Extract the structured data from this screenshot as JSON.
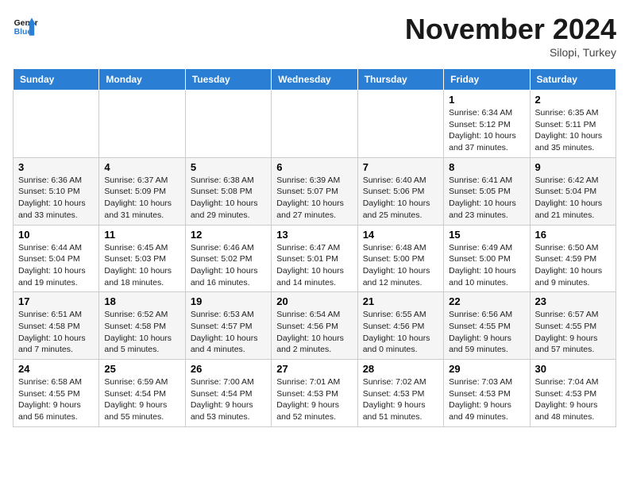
{
  "header": {
    "logo_line1": "General",
    "logo_line2": "Blue",
    "month": "November 2024",
    "location": "Silopi, Turkey"
  },
  "weekdays": [
    "Sunday",
    "Monday",
    "Tuesday",
    "Wednesday",
    "Thursday",
    "Friday",
    "Saturday"
  ],
  "weeks": [
    [
      {
        "day": "",
        "detail": ""
      },
      {
        "day": "",
        "detail": ""
      },
      {
        "day": "",
        "detail": ""
      },
      {
        "day": "",
        "detail": ""
      },
      {
        "day": "",
        "detail": ""
      },
      {
        "day": "1",
        "detail": "Sunrise: 6:34 AM\nSunset: 5:12 PM\nDaylight: 10 hours\nand 37 minutes."
      },
      {
        "day": "2",
        "detail": "Sunrise: 6:35 AM\nSunset: 5:11 PM\nDaylight: 10 hours\nand 35 minutes."
      }
    ],
    [
      {
        "day": "3",
        "detail": "Sunrise: 6:36 AM\nSunset: 5:10 PM\nDaylight: 10 hours\nand 33 minutes."
      },
      {
        "day": "4",
        "detail": "Sunrise: 6:37 AM\nSunset: 5:09 PM\nDaylight: 10 hours\nand 31 minutes."
      },
      {
        "day": "5",
        "detail": "Sunrise: 6:38 AM\nSunset: 5:08 PM\nDaylight: 10 hours\nand 29 minutes."
      },
      {
        "day": "6",
        "detail": "Sunrise: 6:39 AM\nSunset: 5:07 PM\nDaylight: 10 hours\nand 27 minutes."
      },
      {
        "day": "7",
        "detail": "Sunrise: 6:40 AM\nSunset: 5:06 PM\nDaylight: 10 hours\nand 25 minutes."
      },
      {
        "day": "8",
        "detail": "Sunrise: 6:41 AM\nSunset: 5:05 PM\nDaylight: 10 hours\nand 23 minutes."
      },
      {
        "day": "9",
        "detail": "Sunrise: 6:42 AM\nSunset: 5:04 PM\nDaylight: 10 hours\nand 21 minutes."
      }
    ],
    [
      {
        "day": "10",
        "detail": "Sunrise: 6:44 AM\nSunset: 5:04 PM\nDaylight: 10 hours\nand 19 minutes."
      },
      {
        "day": "11",
        "detail": "Sunrise: 6:45 AM\nSunset: 5:03 PM\nDaylight: 10 hours\nand 18 minutes."
      },
      {
        "day": "12",
        "detail": "Sunrise: 6:46 AM\nSunset: 5:02 PM\nDaylight: 10 hours\nand 16 minutes."
      },
      {
        "day": "13",
        "detail": "Sunrise: 6:47 AM\nSunset: 5:01 PM\nDaylight: 10 hours\nand 14 minutes."
      },
      {
        "day": "14",
        "detail": "Sunrise: 6:48 AM\nSunset: 5:00 PM\nDaylight: 10 hours\nand 12 minutes."
      },
      {
        "day": "15",
        "detail": "Sunrise: 6:49 AM\nSunset: 5:00 PM\nDaylight: 10 hours\nand 10 minutes."
      },
      {
        "day": "16",
        "detail": "Sunrise: 6:50 AM\nSunset: 4:59 PM\nDaylight: 10 hours\nand 9 minutes."
      }
    ],
    [
      {
        "day": "17",
        "detail": "Sunrise: 6:51 AM\nSunset: 4:58 PM\nDaylight: 10 hours\nand 7 minutes."
      },
      {
        "day": "18",
        "detail": "Sunrise: 6:52 AM\nSunset: 4:58 PM\nDaylight: 10 hours\nand 5 minutes."
      },
      {
        "day": "19",
        "detail": "Sunrise: 6:53 AM\nSunset: 4:57 PM\nDaylight: 10 hours\nand 4 minutes."
      },
      {
        "day": "20",
        "detail": "Sunrise: 6:54 AM\nSunset: 4:56 PM\nDaylight: 10 hours\nand 2 minutes."
      },
      {
        "day": "21",
        "detail": "Sunrise: 6:55 AM\nSunset: 4:56 PM\nDaylight: 10 hours\nand 0 minutes."
      },
      {
        "day": "22",
        "detail": "Sunrise: 6:56 AM\nSunset: 4:55 PM\nDaylight: 9 hours\nand 59 minutes."
      },
      {
        "day": "23",
        "detail": "Sunrise: 6:57 AM\nSunset: 4:55 PM\nDaylight: 9 hours\nand 57 minutes."
      }
    ],
    [
      {
        "day": "24",
        "detail": "Sunrise: 6:58 AM\nSunset: 4:55 PM\nDaylight: 9 hours\nand 56 minutes."
      },
      {
        "day": "25",
        "detail": "Sunrise: 6:59 AM\nSunset: 4:54 PM\nDaylight: 9 hours\nand 55 minutes."
      },
      {
        "day": "26",
        "detail": "Sunrise: 7:00 AM\nSunset: 4:54 PM\nDaylight: 9 hours\nand 53 minutes."
      },
      {
        "day": "27",
        "detail": "Sunrise: 7:01 AM\nSunset: 4:53 PM\nDaylight: 9 hours\nand 52 minutes."
      },
      {
        "day": "28",
        "detail": "Sunrise: 7:02 AM\nSunset: 4:53 PM\nDaylight: 9 hours\nand 51 minutes."
      },
      {
        "day": "29",
        "detail": "Sunrise: 7:03 AM\nSunset: 4:53 PM\nDaylight: 9 hours\nand 49 minutes."
      },
      {
        "day": "30",
        "detail": "Sunrise: 7:04 AM\nSunset: 4:53 PM\nDaylight: 9 hours\nand 48 minutes."
      }
    ]
  ]
}
